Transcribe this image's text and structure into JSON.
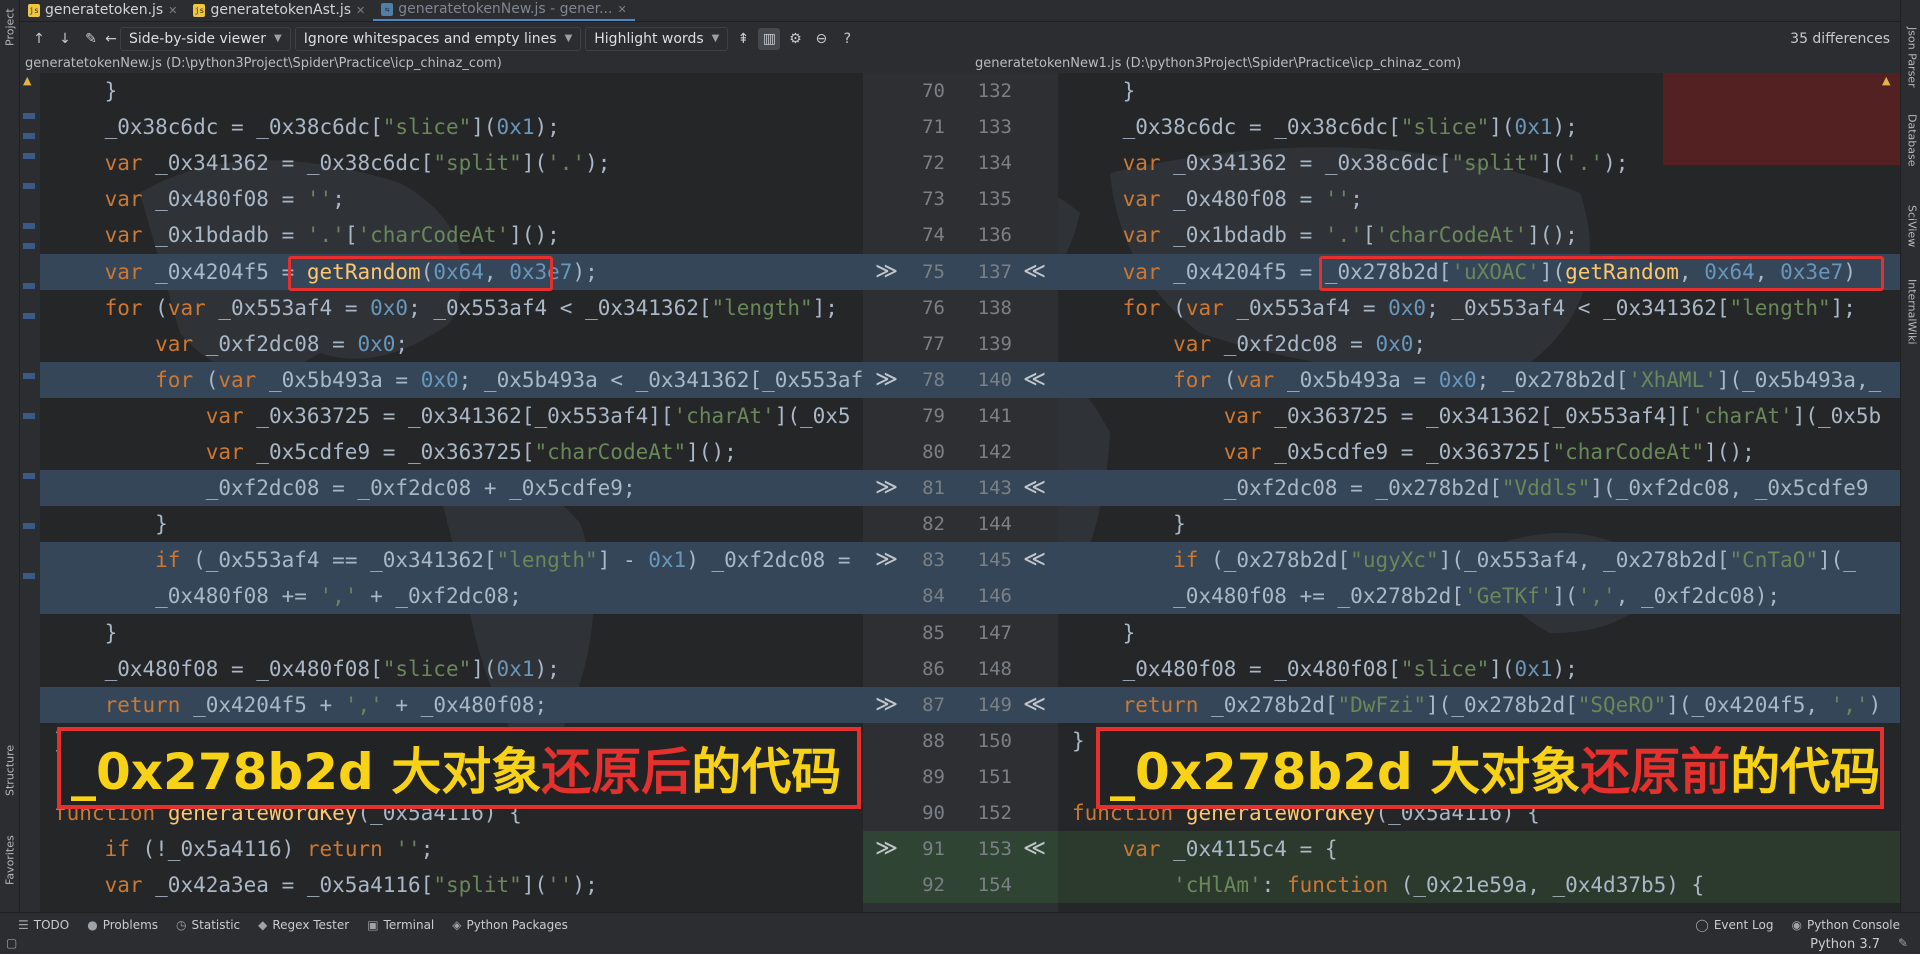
{
  "tabs": [
    {
      "label": "generatetoken.js",
      "active": false
    },
    {
      "label": "generatetokenAst.js",
      "active": false
    },
    {
      "label": "generatetokenNew.js - gener...",
      "active": true
    }
  ],
  "left_rail": {
    "project": "Project",
    "structure": "Structure",
    "favorites": "Favorites"
  },
  "right_rail": {
    "json_parser": "Json Parser",
    "database": "Database",
    "sciview": "SciView",
    "internal_wiki": "InternalWiki"
  },
  "toolbar": {
    "viewer": "Side-by-side viewer",
    "ignore": "Ignore whitespaces and empty lines",
    "highlight": "Highlight words",
    "help": "?",
    "diff_count": "35 differences"
  },
  "paths": {
    "left": "generatetokenNew.js (D:\\python3Project\\Spider\\Practice\\icp_chinaz_com)",
    "right": "generatetokenNew1.js (D:\\python3Project\\Spider\\Practice\\icp_chinaz_com)"
  },
  "gutter_rows": [
    {
      "l": "70",
      "r": "132",
      "hl": "",
      "arrows": false
    },
    {
      "l": "71",
      "r": "133",
      "hl": "",
      "arrows": false
    },
    {
      "l": "72",
      "r": "134",
      "hl": "",
      "arrows": false
    },
    {
      "l": "73",
      "r": "135",
      "hl": "",
      "arrows": false
    },
    {
      "l": "74",
      "r": "136",
      "hl": "",
      "arrows": false
    },
    {
      "l": "75",
      "r": "137",
      "hl": "hl",
      "arrows": true
    },
    {
      "l": "76",
      "r": "138",
      "hl": "",
      "arrows": false
    },
    {
      "l": "77",
      "r": "139",
      "hl": "",
      "arrows": false
    },
    {
      "l": "78",
      "r": "140",
      "hl": "hl",
      "arrows": true
    },
    {
      "l": "79",
      "r": "141",
      "hl": "",
      "arrows": false
    },
    {
      "l": "80",
      "r": "142",
      "hl": "",
      "arrows": false
    },
    {
      "l": "81",
      "r": "143",
      "hl": "hl",
      "arrows": true
    },
    {
      "l": "82",
      "r": "144",
      "hl": "",
      "arrows": false
    },
    {
      "l": "83",
      "r": "145",
      "hl": "hl",
      "arrows": true
    },
    {
      "l": "84",
      "r": "146",
      "hl": "hl",
      "arrows": false
    },
    {
      "l": "85",
      "r": "147",
      "hl": "",
      "arrows": false
    },
    {
      "l": "86",
      "r": "148",
      "hl": "",
      "arrows": false
    },
    {
      "l": "87",
      "r": "149",
      "hl": "hl",
      "arrows": true
    },
    {
      "l": "88",
      "r": "150",
      "hl": "",
      "arrows": false
    },
    {
      "l": "89",
      "r": "151",
      "hl": "",
      "arrows": false
    },
    {
      "l": "90",
      "r": "152",
      "hl": "",
      "arrows": false
    },
    {
      "l": "91",
      "r": "153",
      "hl": "hlg",
      "arrows": true
    },
    {
      "l": "92",
      "r": "154",
      "hl": "hlg",
      "arrows": false
    }
  ],
  "left_code": [
    {
      "hl": "",
      "segs": [
        [
          "    }",
          ""
        ]
      ]
    },
    {
      "hl": "",
      "segs": [
        [
          "    _0x38c6dc = _0x38c6dc[",
          ""
        ],
        [
          "\"slice\"",
          "str"
        ],
        [
          "](",
          ""
        ],
        [
          "0x1",
          "num"
        ],
        [
          ");",
          ""
        ]
      ]
    },
    {
      "hl": "",
      "segs": [
        [
          "    ",
          ""
        ],
        [
          "var",
          "kw"
        ],
        [
          " _0x341362 = _0x38c6dc[",
          ""
        ],
        [
          "\"split\"",
          "str"
        ],
        [
          "](",
          ""
        ],
        [
          "'.'",
          "str"
        ],
        [
          ");",
          ""
        ]
      ]
    },
    {
      "hl": "",
      "segs": [
        [
          "    ",
          ""
        ],
        [
          "var",
          "kw"
        ],
        [
          " _0x480f08 = ",
          ""
        ],
        [
          "''",
          "str"
        ],
        [
          ";",
          ""
        ]
      ]
    },
    {
      "hl": "",
      "segs": [
        [
          "    ",
          ""
        ],
        [
          "var",
          "kw"
        ],
        [
          " _0x1bdadb = ",
          ""
        ],
        [
          "'.'",
          "str"
        ],
        [
          "[",
          ""
        ],
        [
          "'charCodeAt'",
          "str"
        ],
        [
          "]();",
          ""
        ]
      ]
    },
    {
      "hl": "hl",
      "segs": [
        [
          "    ",
          ""
        ],
        [
          "var",
          "kw"
        ],
        [
          " _0x4204f5 = ",
          ""
        ],
        [
          "getRandom",
          "fn"
        ],
        [
          "(",
          ""
        ],
        [
          "0x64",
          "num"
        ],
        [
          ", ",
          ""
        ],
        [
          "0x3e7",
          "num"
        ],
        [
          ");",
          ""
        ]
      ]
    },
    {
      "hl": "",
      "segs": [
        [
          "    ",
          ""
        ],
        [
          "for",
          "kw"
        ],
        [
          " (",
          ""
        ],
        [
          "var",
          "kw"
        ],
        [
          " _0x553af4 = ",
          ""
        ],
        [
          "0x0",
          "num"
        ],
        [
          "; _0x553af4 < _0x341362[",
          ""
        ],
        [
          "\"length\"",
          "str"
        ],
        [
          "];",
          ""
        ]
      ]
    },
    {
      "hl": "",
      "segs": [
        [
          "        ",
          ""
        ],
        [
          "var",
          "kw"
        ],
        [
          " _0xf2dc08 = ",
          ""
        ],
        [
          "0x0",
          "num"
        ],
        [
          ";",
          ""
        ]
      ]
    },
    {
      "hl": "hl",
      "segs": [
        [
          "        ",
          ""
        ],
        [
          "for",
          "kw"
        ],
        [
          " (",
          ""
        ],
        [
          "var",
          "kw"
        ],
        [
          " _0x5b493a = ",
          ""
        ],
        [
          "0x0",
          "num"
        ],
        [
          "; _0x5b493a < _0x341362[_0x553af",
          ""
        ]
      ]
    },
    {
      "hl": "",
      "segs": [
        [
          "            ",
          ""
        ],
        [
          "var",
          "kw"
        ],
        [
          " _0x363725 = _0x341362[_0x553af4][",
          ""
        ],
        [
          "'charAt'",
          "str"
        ],
        [
          "](_0x5",
          ""
        ]
      ]
    },
    {
      "hl": "",
      "segs": [
        [
          "            ",
          ""
        ],
        [
          "var",
          "kw"
        ],
        [
          " _0x5cdfe9 = _0x363725[",
          ""
        ],
        [
          "\"charCodeAt\"",
          "str"
        ],
        [
          "]();",
          ""
        ]
      ]
    },
    {
      "hl": "hl",
      "segs": [
        [
          "            _0xf2dc08 = _0xf2dc08 + _0x5cdfe9;",
          ""
        ]
      ]
    },
    {
      "hl": "",
      "segs": [
        [
          "        }",
          ""
        ]
      ]
    },
    {
      "hl": "hl",
      "segs": [
        [
          "        ",
          ""
        ],
        [
          "if",
          "kw"
        ],
        [
          " (_0x553af4 == _0x341362[",
          ""
        ],
        [
          "\"length\"",
          "str"
        ],
        [
          "] - ",
          ""
        ],
        [
          "0x1",
          "num"
        ],
        [
          ") _0xf2dc08 =",
          ""
        ]
      ]
    },
    {
      "hl": "hl",
      "segs": [
        [
          "        _0x480f08 += ",
          ""
        ],
        [
          "','",
          "str"
        ],
        [
          " + _0xf2dc08;",
          ""
        ]
      ]
    },
    {
      "hl": "",
      "segs": [
        [
          "    }",
          ""
        ]
      ]
    },
    {
      "hl": "",
      "segs": [
        [
          "    _0x480f08 = _0x480f08[",
          ""
        ],
        [
          "\"slice\"",
          "str"
        ],
        [
          "](",
          ""
        ],
        [
          "0x1",
          "num"
        ],
        [
          ");",
          ""
        ]
      ]
    },
    {
      "hl": "hl",
      "segs": [
        [
          "    ",
          ""
        ],
        [
          "return",
          "kw"
        ],
        [
          " _0x4204f5 + ",
          ""
        ],
        [
          "','",
          "str"
        ],
        [
          " + _0x480f08;",
          ""
        ]
      ]
    },
    {
      "hl": "",
      "segs": [
        [
          "}",
          ""
        ]
      ]
    },
    {
      "hl": "",
      "segs": [
        [
          "",
          ""
        ]
      ]
    },
    {
      "hl": "",
      "segs": [
        [
          "function",
          "kw"
        ],
        [
          " ",
          ""
        ],
        [
          "generateWordKey",
          "fn"
        ],
        [
          "(_0x5a4116) {",
          ""
        ]
      ]
    },
    {
      "hl": "",
      "segs": [
        [
          "    ",
          ""
        ],
        [
          "if",
          "kw"
        ],
        [
          " (!_0x5a4116) ",
          ""
        ],
        [
          "return",
          "kw"
        ],
        [
          " ",
          ""
        ],
        [
          "''",
          "str"
        ],
        [
          ";",
          ""
        ]
      ]
    },
    {
      "hl": "",
      "segs": [
        [
          "    ",
          ""
        ],
        [
          "var",
          "kw"
        ],
        [
          " _0x42a3ea = _0x5a4116[",
          ""
        ],
        [
          "\"split\"",
          "str"
        ],
        [
          "](",
          ""
        ],
        [
          "''",
          "str"
        ],
        [
          ");",
          ""
        ]
      ]
    }
  ],
  "right_code": [
    {
      "hl": "",
      "segs": [
        [
          "    }",
          ""
        ]
      ]
    },
    {
      "hl": "",
      "segs": [
        [
          "    _0x38c6dc = _0x38c6dc[",
          ""
        ],
        [
          "\"slice\"",
          "str"
        ],
        [
          "](",
          ""
        ],
        [
          "0x1",
          "num"
        ],
        [
          ");",
          ""
        ]
      ]
    },
    {
      "hl": "",
      "segs": [
        [
          "    ",
          ""
        ],
        [
          "var",
          "kw"
        ],
        [
          " _0x341362 = _0x38c6dc[",
          ""
        ],
        [
          "\"split\"",
          "str"
        ],
        [
          "](",
          ""
        ],
        [
          "'.'",
          "str"
        ],
        [
          ");",
          ""
        ]
      ]
    },
    {
      "hl": "",
      "segs": [
        [
          "    ",
          ""
        ],
        [
          "var",
          "kw"
        ],
        [
          " _0x480f08 = ",
          ""
        ],
        [
          "''",
          "str"
        ],
        [
          ";",
          ""
        ]
      ]
    },
    {
      "hl": "",
      "segs": [
        [
          "    ",
          ""
        ],
        [
          "var",
          "kw"
        ],
        [
          " _0x1bdadb = ",
          ""
        ],
        [
          "'.'",
          "str"
        ],
        [
          "[",
          ""
        ],
        [
          "'charCodeAt'",
          "str"
        ],
        [
          "]();",
          ""
        ]
      ]
    },
    {
      "hl": "hl",
      "segs": [
        [
          "    ",
          ""
        ],
        [
          "var",
          "kw"
        ],
        [
          " _0x4204f5 = _0x278b2d[",
          ""
        ],
        [
          "'uXOAC'",
          "str"
        ],
        [
          "](",
          ""
        ],
        [
          "getRandom",
          "fn"
        ],
        [
          ", ",
          ""
        ],
        [
          "0x64",
          "num"
        ],
        [
          ", ",
          ""
        ],
        [
          "0x3e7",
          "num"
        ],
        [
          ")",
          ""
        ]
      ]
    },
    {
      "hl": "",
      "segs": [
        [
          "    ",
          ""
        ],
        [
          "for",
          "kw"
        ],
        [
          " (",
          ""
        ],
        [
          "var",
          "kw"
        ],
        [
          " _0x553af4 = ",
          ""
        ],
        [
          "0x0",
          "num"
        ],
        [
          "; _0x553af4 < _0x341362[",
          ""
        ],
        [
          "\"length\"",
          "str"
        ],
        [
          "];",
          ""
        ]
      ]
    },
    {
      "hl": "",
      "segs": [
        [
          "        ",
          ""
        ],
        [
          "var",
          "kw"
        ],
        [
          " _0xf2dc08 = ",
          ""
        ],
        [
          "0x0",
          "num"
        ],
        [
          ";",
          ""
        ]
      ]
    },
    {
      "hl": "hl",
      "segs": [
        [
          "        ",
          ""
        ],
        [
          "for",
          "kw"
        ],
        [
          " (",
          ""
        ],
        [
          "var",
          "kw"
        ],
        [
          " _0x5b493a = ",
          ""
        ],
        [
          "0x0",
          "num"
        ],
        [
          "; _0x278b2d[",
          ""
        ],
        [
          "'XhAML'",
          "str"
        ],
        [
          "](_0x5b493a,_",
          ""
        ]
      ]
    },
    {
      "hl": "",
      "segs": [
        [
          "            ",
          ""
        ],
        [
          "var",
          "kw"
        ],
        [
          " _0x363725 = _0x341362[_0x553af4][",
          ""
        ],
        [
          "'charAt'",
          "str"
        ],
        [
          "](_0x5b",
          ""
        ]
      ]
    },
    {
      "hl": "",
      "segs": [
        [
          "            ",
          ""
        ],
        [
          "var",
          "kw"
        ],
        [
          " _0x5cdfe9 = _0x363725[",
          ""
        ],
        [
          "\"charCodeAt\"",
          "str"
        ],
        [
          "]();",
          ""
        ]
      ]
    },
    {
      "hl": "hl",
      "segs": [
        [
          "            _0xf2dc08 = _0x278b2d[",
          ""
        ],
        [
          "\"Vddls\"",
          "str"
        ],
        [
          "](_0xf2dc08, _0x5cdfe9",
          ""
        ]
      ]
    },
    {
      "hl": "",
      "segs": [
        [
          "        }",
          ""
        ]
      ]
    },
    {
      "hl": "hl",
      "segs": [
        [
          "        ",
          ""
        ],
        [
          "if",
          "kw"
        ],
        [
          " (_0x278b2d[",
          ""
        ],
        [
          "\"ugyXc\"",
          "str"
        ],
        [
          "](_0x553af4, _0x278b2d[",
          ""
        ],
        [
          "\"CnTaO\"",
          "str"
        ],
        [
          "](_",
          ""
        ]
      ]
    },
    {
      "hl": "hl",
      "segs": [
        [
          "        _0x480f08 += _0x278b2d[",
          ""
        ],
        [
          "'GeTKf'",
          "str"
        ],
        [
          "](",
          ""
        ],
        [
          "','",
          "str"
        ],
        [
          ", _0xf2dc08);",
          ""
        ]
      ]
    },
    {
      "hl": "",
      "segs": [
        [
          "    }",
          ""
        ]
      ]
    },
    {
      "hl": "",
      "segs": [
        [
          "    _0x480f08 = _0x480f08[",
          ""
        ],
        [
          "\"slice\"",
          "str"
        ],
        [
          "](",
          ""
        ],
        [
          "0x1",
          "num"
        ],
        [
          ");",
          ""
        ]
      ]
    },
    {
      "hl": "hl",
      "segs": [
        [
          "    ",
          ""
        ],
        [
          "return",
          "kw"
        ],
        [
          " _0x278b2d[",
          ""
        ],
        [
          "\"DwFzi\"",
          "str"
        ],
        [
          "](_0x278b2d[",
          ""
        ],
        [
          "\"SQeRO\"",
          "str"
        ],
        [
          "](_0x4204f5, ",
          ""
        ],
        [
          "','",
          "str"
        ],
        [
          ")",
          ""
        ]
      ]
    },
    {
      "hl": "",
      "segs": [
        [
          "}",
          ""
        ]
      ]
    },
    {
      "hl": "",
      "segs": [
        [
          "",
          ""
        ]
      ]
    },
    {
      "hl": "",
      "segs": [
        [
          "function",
          "kw"
        ],
        [
          " ",
          ""
        ],
        [
          "generateWordKey",
          "fn"
        ],
        [
          "(_0x5a4116) {",
          ""
        ]
      ]
    },
    {
      "hl": "hlg",
      "segs": [
        [
          "    ",
          ""
        ],
        [
          "var",
          "kw"
        ],
        [
          " _0x4115c4 = {",
          ""
        ]
      ]
    },
    {
      "hl": "hlg",
      "segs": [
        [
          "        ",
          ""
        ],
        [
          "'cHlAm'",
          "str"
        ],
        [
          ": ",
          ""
        ],
        [
          "function",
          "kw"
        ],
        [
          " (_0x21e59a, _0x4d37b5) {",
          ""
        ]
      ]
    }
  ],
  "annotations": {
    "left": {
      "prefix": "_0x278b2d 大对象",
      "red": "还原后",
      "suffix": "的代码"
    },
    "right": {
      "prefix": "_0x278b2d 大对象",
      "red": "还原前",
      "suffix": "的代码"
    }
  },
  "bottom_tools": [
    {
      "icon": "todo-icon",
      "glyph": "☰",
      "label": "TODO"
    },
    {
      "icon": "problems-icon",
      "glyph": "●",
      "label": "Problems"
    },
    {
      "icon": "statistic-icon",
      "glyph": "◷",
      "label": "Statistic"
    },
    {
      "icon": "regex-icon",
      "glyph": "◆",
      "label": "Regex Tester"
    },
    {
      "icon": "terminal-icon",
      "glyph": "▣",
      "label": "Terminal"
    },
    {
      "icon": "python-packages-icon",
      "glyph": "◈",
      "label": "Python Packages"
    }
  ],
  "bottom_right_tools": [
    {
      "icon": "event-log-icon",
      "glyph": "◯",
      "label": "Event Log"
    },
    {
      "icon": "python-console-icon",
      "glyph": "◉",
      "label": "Python Console"
    }
  ],
  "status": {
    "interpreter": "Python 3.7"
  },
  "colors": {
    "keyword": "#cc7832",
    "string": "#6a8759",
    "number": "#6897bb",
    "function": "#ffc66d",
    "changed_bg": "#344658",
    "inserted_bg": "#2f4432",
    "annotation_red": "#e4312e",
    "annotation_yellow": "#f8d216"
  }
}
